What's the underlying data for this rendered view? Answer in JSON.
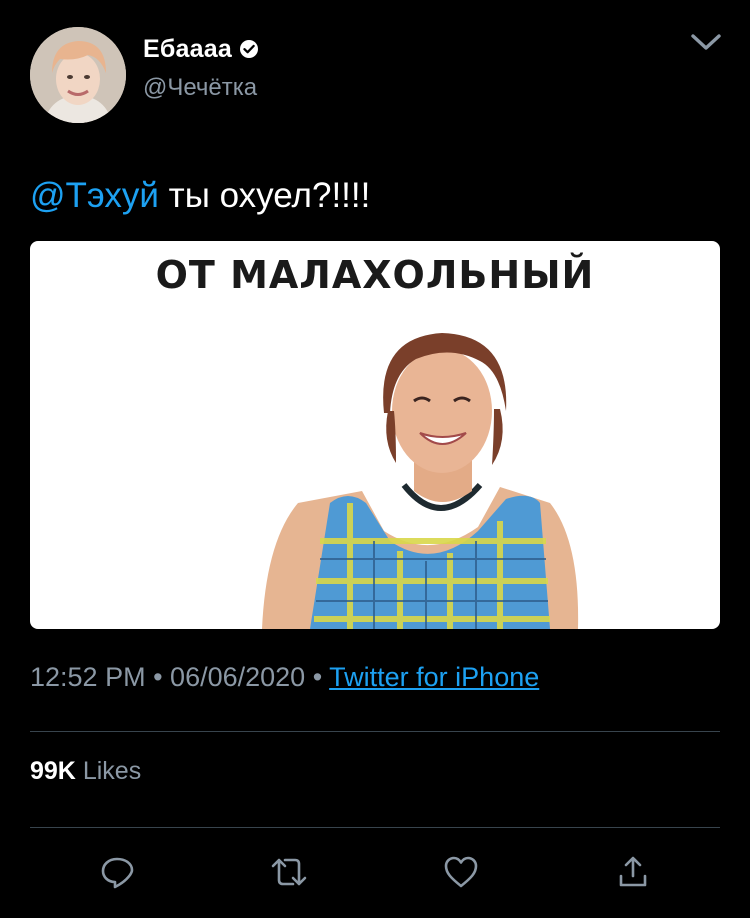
{
  "author": {
    "display_name": "Ебаааа",
    "handle": "@Чечётка",
    "verified": true,
    "avatar_icon": "avatar-photo"
  },
  "tweet": {
    "mention": "@Тэхуй",
    "text": " ты охуел?!!!!",
    "media": {
      "caption": "ОТ МАЛАХОЛЬНЫЙ",
      "image_icon": "smiling-woman-photo"
    }
  },
  "meta": {
    "time": "12:52 PM",
    "separator1": " • ",
    "date": "06/06/2020",
    "separator2": " • ",
    "source": "Twitter for iPhone"
  },
  "stats": {
    "likes_count": "99K",
    "likes_label": "Likes"
  },
  "actions": {
    "reply_icon": "reply-icon",
    "retweet_icon": "retweet-icon",
    "like_icon": "heart-icon",
    "share_icon": "share-icon"
  },
  "colors": {
    "background": "#000000",
    "link": "#1da1f2",
    "secondary_text": "#8b98a5",
    "divider": "#38444d"
  }
}
